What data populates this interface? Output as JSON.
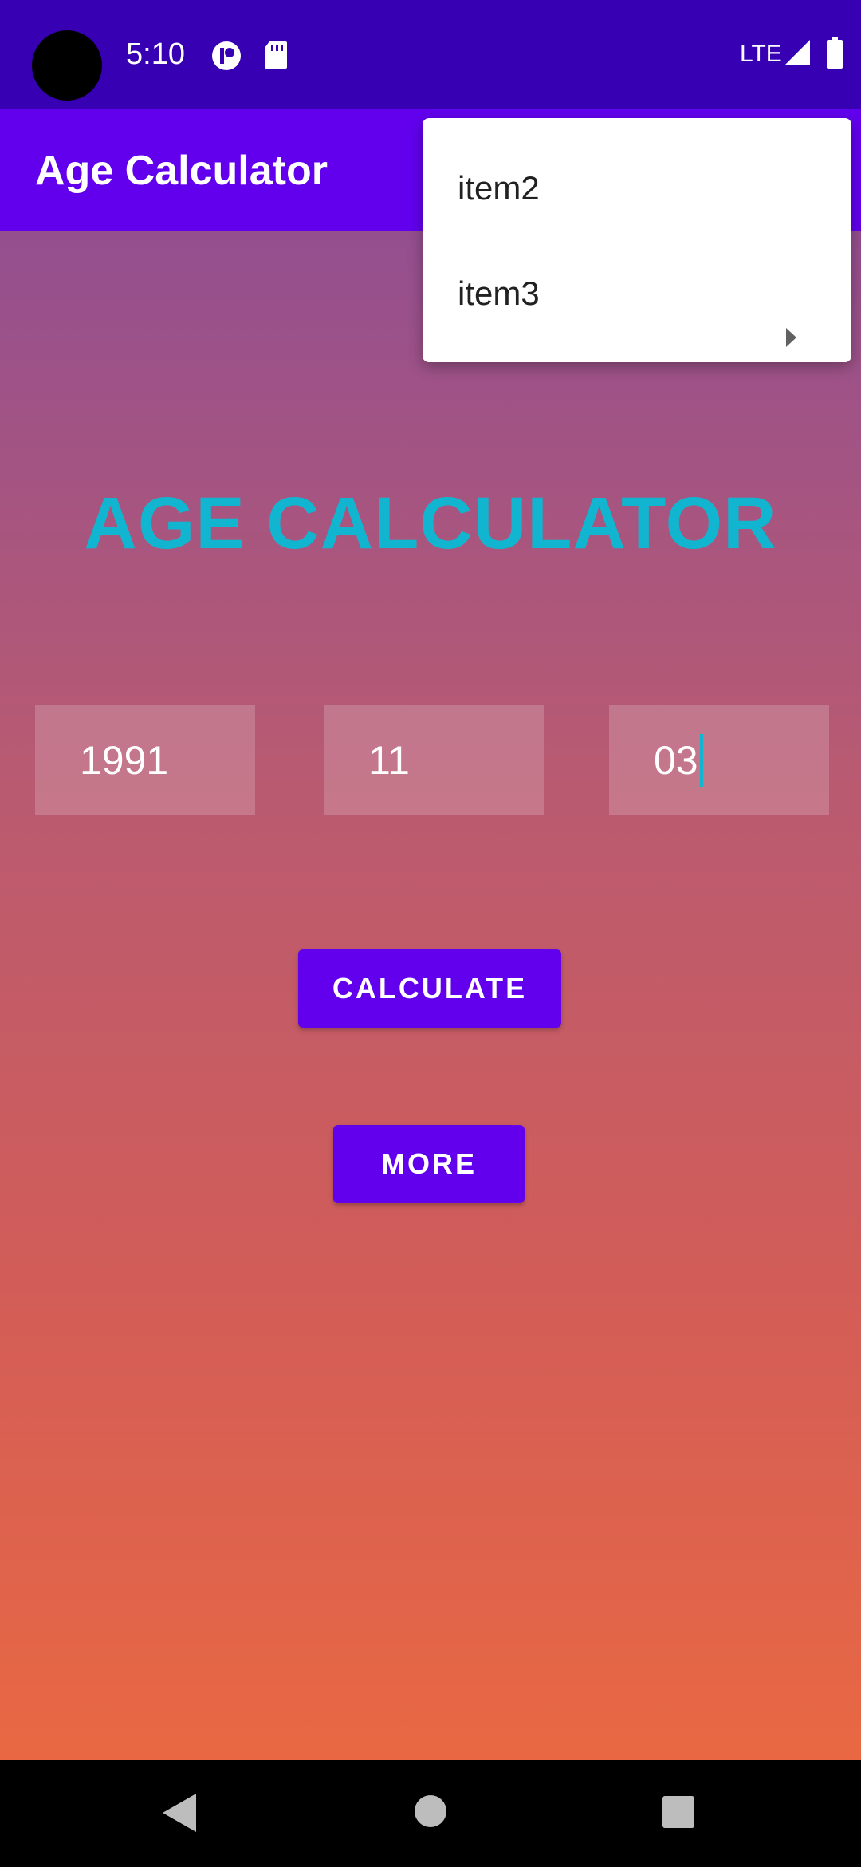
{
  "status_bar": {
    "time": "5:10",
    "network": "LTE",
    "icons": [
      "camera-cutout",
      "notification-icon",
      "sd-card-icon",
      "signal-icon",
      "battery-icon"
    ]
  },
  "app_bar": {
    "title": "Age Calculator"
  },
  "main": {
    "headline": "AGE CALCULATOR",
    "fields": {
      "year": "1991",
      "month": "11",
      "day": "03"
    },
    "buttons": {
      "calculate": "CALCULATE",
      "more": "MORE"
    }
  },
  "overflow_menu": {
    "items": [
      {
        "label": "item2"
      },
      {
        "label": "item3",
        "has_submenu": true
      }
    ]
  },
  "navigation": {
    "buttons": [
      "back-icon",
      "home-icon",
      "recents-icon"
    ]
  },
  "colors": {
    "status_bar": "#3700b3",
    "app_bar": "#6200ee",
    "headline": "#12b5cf",
    "button": "#6200ee",
    "gradient_top": "#944f8f",
    "gradient_bottom": "#e96843"
  }
}
